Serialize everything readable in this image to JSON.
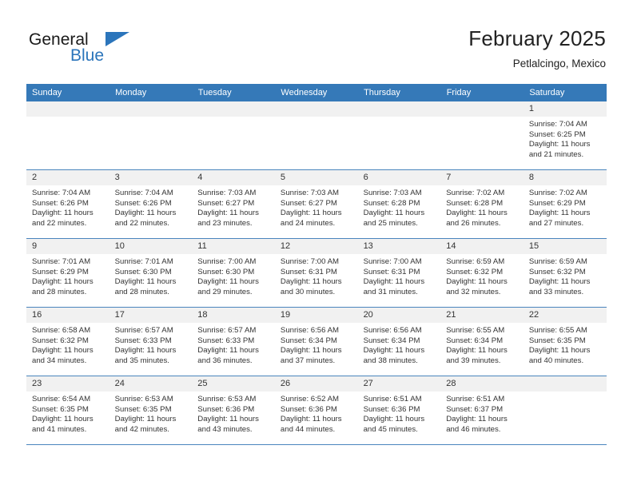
{
  "brand": {
    "name_part1": "General",
    "name_part2": "Blue",
    "accent_color": "#2b75bb"
  },
  "header": {
    "title": "February 2025",
    "subtitle": "Petlalcingo, Mexico"
  },
  "theme": {
    "header_blue": "#3579b8",
    "row_divider_blue": "#4a85bd",
    "daynum_bg": "#f1f1f1"
  },
  "weekdays": [
    "Sunday",
    "Monday",
    "Tuesday",
    "Wednesday",
    "Thursday",
    "Friday",
    "Saturday"
  ],
  "weeks": [
    [
      {
        "day": "",
        "lines": []
      },
      {
        "day": "",
        "lines": []
      },
      {
        "day": "",
        "lines": []
      },
      {
        "day": "",
        "lines": []
      },
      {
        "day": "",
        "lines": []
      },
      {
        "day": "",
        "lines": []
      },
      {
        "day": "1",
        "lines": [
          "Sunrise: 7:04 AM",
          "Sunset: 6:25 PM",
          "Daylight: 11 hours and 21 minutes."
        ]
      }
    ],
    [
      {
        "day": "2",
        "lines": [
          "Sunrise: 7:04 AM",
          "Sunset: 6:26 PM",
          "Daylight: 11 hours and 22 minutes."
        ]
      },
      {
        "day": "3",
        "lines": [
          "Sunrise: 7:04 AM",
          "Sunset: 6:26 PM",
          "Daylight: 11 hours and 22 minutes."
        ]
      },
      {
        "day": "4",
        "lines": [
          "Sunrise: 7:03 AM",
          "Sunset: 6:27 PM",
          "Daylight: 11 hours and 23 minutes."
        ]
      },
      {
        "day": "5",
        "lines": [
          "Sunrise: 7:03 AM",
          "Sunset: 6:27 PM",
          "Daylight: 11 hours and 24 minutes."
        ]
      },
      {
        "day": "6",
        "lines": [
          "Sunrise: 7:03 AM",
          "Sunset: 6:28 PM",
          "Daylight: 11 hours and 25 minutes."
        ]
      },
      {
        "day": "7",
        "lines": [
          "Sunrise: 7:02 AM",
          "Sunset: 6:28 PM",
          "Daylight: 11 hours and 26 minutes."
        ]
      },
      {
        "day": "8",
        "lines": [
          "Sunrise: 7:02 AM",
          "Sunset: 6:29 PM",
          "Daylight: 11 hours and 27 minutes."
        ]
      }
    ],
    [
      {
        "day": "9",
        "lines": [
          "Sunrise: 7:01 AM",
          "Sunset: 6:29 PM",
          "Daylight: 11 hours and 28 minutes."
        ]
      },
      {
        "day": "10",
        "lines": [
          "Sunrise: 7:01 AM",
          "Sunset: 6:30 PM",
          "Daylight: 11 hours and 28 minutes."
        ]
      },
      {
        "day": "11",
        "lines": [
          "Sunrise: 7:00 AM",
          "Sunset: 6:30 PM",
          "Daylight: 11 hours and 29 minutes."
        ]
      },
      {
        "day": "12",
        "lines": [
          "Sunrise: 7:00 AM",
          "Sunset: 6:31 PM",
          "Daylight: 11 hours and 30 minutes."
        ]
      },
      {
        "day": "13",
        "lines": [
          "Sunrise: 7:00 AM",
          "Sunset: 6:31 PM",
          "Daylight: 11 hours and 31 minutes."
        ]
      },
      {
        "day": "14",
        "lines": [
          "Sunrise: 6:59 AM",
          "Sunset: 6:32 PM",
          "Daylight: 11 hours and 32 minutes."
        ]
      },
      {
        "day": "15",
        "lines": [
          "Sunrise: 6:59 AM",
          "Sunset: 6:32 PM",
          "Daylight: 11 hours and 33 minutes."
        ]
      }
    ],
    [
      {
        "day": "16",
        "lines": [
          "Sunrise: 6:58 AM",
          "Sunset: 6:32 PM",
          "Daylight: 11 hours and 34 minutes."
        ]
      },
      {
        "day": "17",
        "lines": [
          "Sunrise: 6:57 AM",
          "Sunset: 6:33 PM",
          "Daylight: 11 hours and 35 minutes."
        ]
      },
      {
        "day": "18",
        "lines": [
          "Sunrise: 6:57 AM",
          "Sunset: 6:33 PM",
          "Daylight: 11 hours and 36 minutes."
        ]
      },
      {
        "day": "19",
        "lines": [
          "Sunrise: 6:56 AM",
          "Sunset: 6:34 PM",
          "Daylight: 11 hours and 37 minutes."
        ]
      },
      {
        "day": "20",
        "lines": [
          "Sunrise: 6:56 AM",
          "Sunset: 6:34 PM",
          "Daylight: 11 hours and 38 minutes."
        ]
      },
      {
        "day": "21",
        "lines": [
          "Sunrise: 6:55 AM",
          "Sunset: 6:34 PM",
          "Daylight: 11 hours and 39 minutes."
        ]
      },
      {
        "day": "22",
        "lines": [
          "Sunrise: 6:55 AM",
          "Sunset: 6:35 PM",
          "Daylight: 11 hours and 40 minutes."
        ]
      }
    ],
    [
      {
        "day": "23",
        "lines": [
          "Sunrise: 6:54 AM",
          "Sunset: 6:35 PM",
          "Daylight: 11 hours and 41 minutes."
        ]
      },
      {
        "day": "24",
        "lines": [
          "Sunrise: 6:53 AM",
          "Sunset: 6:35 PM",
          "Daylight: 11 hours and 42 minutes."
        ]
      },
      {
        "day": "25",
        "lines": [
          "Sunrise: 6:53 AM",
          "Sunset: 6:36 PM",
          "Daylight: 11 hours and 43 minutes."
        ]
      },
      {
        "day": "26",
        "lines": [
          "Sunrise: 6:52 AM",
          "Sunset: 6:36 PM",
          "Daylight: 11 hours and 44 minutes."
        ]
      },
      {
        "day": "27",
        "lines": [
          "Sunrise: 6:51 AM",
          "Sunset: 6:36 PM",
          "Daylight: 11 hours and 45 minutes."
        ]
      },
      {
        "day": "28",
        "lines": [
          "Sunrise: 6:51 AM",
          "Sunset: 6:37 PM",
          "Daylight: 11 hours and 46 minutes."
        ]
      },
      {
        "day": "",
        "lines": []
      }
    ]
  ]
}
